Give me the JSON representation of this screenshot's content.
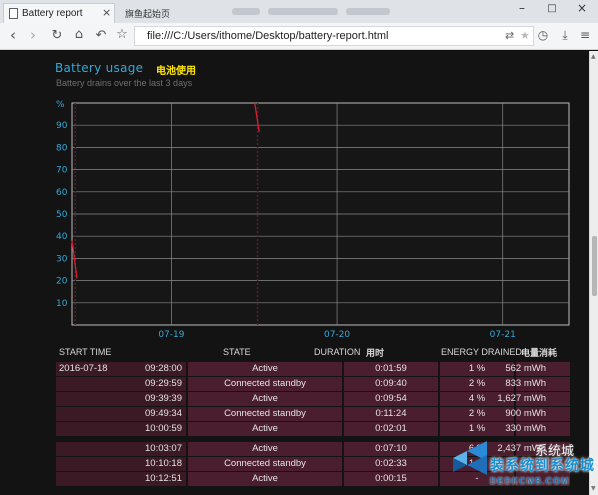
{
  "browser": {
    "tab_active_label": "Battery report",
    "tab_close_glyph": "×",
    "tab_inactive_label": "旗鱼起始页",
    "window_min": "–",
    "window_max": "□",
    "window_close": "×",
    "address": "file:///C:/Users/ithome/Desktop/battery-report.html",
    "icons": [
      "back-icon",
      "forward-icon",
      "refresh-icon",
      "home-icon",
      "undo-icon",
      "star-icon",
      "translate-icon",
      "history-icon",
      "download-icon",
      "menu-icon"
    ]
  },
  "section": {
    "title": "Battery usage",
    "title_annotation": "电池使用",
    "subtitle": "Battery drains over the last 3 days"
  },
  "chart_data": {
    "type": "line",
    "title": "Battery usage",
    "ylabel": "%",
    "yticks": [
      "10",
      "20",
      "30",
      "40",
      "50",
      "60",
      "70",
      "80",
      "90"
    ],
    "ylim": [
      0,
      100
    ],
    "xticks": [
      "07-19",
      "07-20",
      "07-21"
    ],
    "xlim": [
      0,
      3
    ],
    "grid": true,
    "series_color": "#d81e2f",
    "series": [
      {
        "x": [
          0.0,
          0.03
        ],
        "y": [
          38,
          21
        ]
      },
      {
        "x": [
          1.103,
          1.13
        ],
        "y": [
          100,
          87
        ]
      }
    ],
    "faint_marks_x": [
      0.02,
      1.12
    ]
  },
  "table": {
    "headers": {
      "start_time": "START TIME",
      "state": "STATE",
      "duration": "DURATION",
      "duration_annotation": "用时",
      "energy": "ENERGY DRAINED",
      "energy_annotation": "电量消耗"
    },
    "rows": [
      {
        "date": "2016-07-18",
        "time": "09:28:00",
        "state": "Active",
        "duration": "0:01:59",
        "percent": "1 %",
        "energy": "562 mWh"
      },
      {
        "date": "",
        "time": "09:29:59",
        "state": "Connected standby",
        "duration": "0:09:40",
        "percent": "2 %",
        "energy": "833 mWh"
      },
      {
        "date": "",
        "time": "09:39:39",
        "state": "Active",
        "duration": "0:09:54",
        "percent": "4 %",
        "energy": "1,627 mWh"
      },
      {
        "date": "",
        "time": "09:49:34",
        "state": "Connected standby",
        "duration": "0:11:24",
        "percent": "2 %",
        "energy": "900 mWh"
      },
      {
        "date": "",
        "time": "10:00:59",
        "state": "Active",
        "duration": "0:02:01",
        "percent": "1 %",
        "energy": "330 mWh"
      },
      {
        "date": "",
        "time": "10:03:07",
        "state": "Active",
        "duration": "0:07:10",
        "percent": "6 %",
        "energy": "2,437 mWh"
      },
      {
        "date": "",
        "time": "10:10:18",
        "state": "Connected standby",
        "duration": "0:02:33",
        "percent": "1 %",
        "energy": ""
      },
      {
        "date": "",
        "time": "10:12:51",
        "state": "Active",
        "duration": "0:00:15",
        "percent": "-",
        "energy": ""
      }
    ]
  },
  "watermark": {
    "site": "系统城",
    "text": "装系统到系统城",
    "url": "DEDECMS.COM"
  }
}
